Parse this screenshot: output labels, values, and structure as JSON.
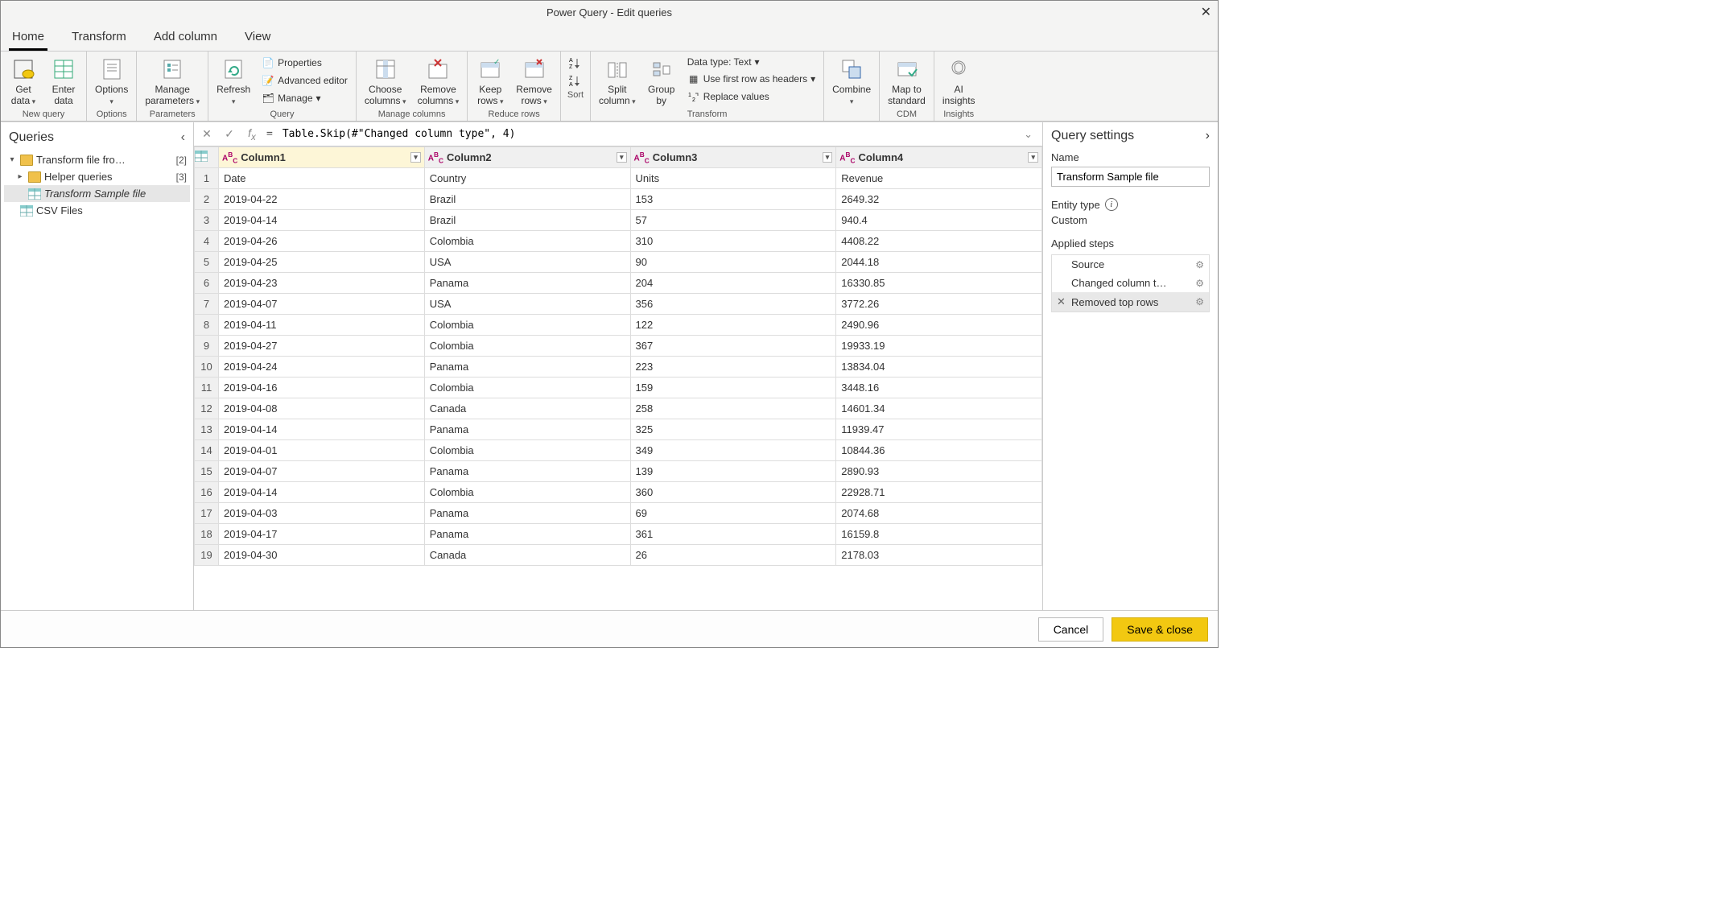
{
  "title": "Power Query - Edit queries",
  "tabs": [
    "Home",
    "Transform",
    "Add column",
    "View"
  ],
  "activeTab": 0,
  "ribbon": {
    "groups": [
      {
        "label": "New query",
        "items": [
          "Get data",
          "Enter data"
        ]
      },
      {
        "label": "Options",
        "items": [
          "Options"
        ]
      },
      {
        "label": "Parameters",
        "items": [
          "Manage parameters"
        ]
      },
      {
        "label": "Query",
        "items": [
          "Refresh"
        ],
        "small": [
          "Properties",
          "Advanced editor",
          "Manage"
        ]
      },
      {
        "label": "Manage columns",
        "items": [
          "Choose columns",
          "Remove columns"
        ]
      },
      {
        "label": "Reduce rows",
        "items": [
          "Keep rows",
          "Remove rows"
        ]
      },
      {
        "label": "Sort",
        "items": []
      },
      {
        "label": "Transform",
        "items": [
          "Split column",
          "Group by"
        ],
        "small": [
          "Data type: Text",
          "Use first row as headers",
          "Replace values"
        ]
      },
      {
        "label": "",
        "items": [
          "Combine"
        ]
      },
      {
        "label": "CDM",
        "items": [
          "Map to standard"
        ]
      },
      {
        "label": "Insights",
        "items": [
          "AI insights"
        ]
      }
    ]
  },
  "queriesPane": {
    "title": "Queries",
    "items": [
      {
        "type": "folder",
        "label": "Transform file fro…",
        "count": "[2]",
        "level": 0,
        "expanded": true
      },
      {
        "type": "folder",
        "label": "Helper queries",
        "count": "[3]",
        "level": 1,
        "expanded": false
      },
      {
        "type": "query",
        "label": "Transform Sample file",
        "level": 1,
        "selected": true
      },
      {
        "type": "query",
        "label": "CSV Files",
        "level": 0
      }
    ]
  },
  "formula": "Table.Skip(#\"Changed column type\", 4)",
  "columns": [
    "Column1",
    "Column2",
    "Column3",
    "Column4"
  ],
  "rows": [
    [
      "Date",
      "Country",
      "Units",
      "Revenue"
    ],
    [
      "2019-04-22",
      "Brazil",
      "153",
      "2649.32"
    ],
    [
      "2019-04-14",
      "Brazil",
      "57",
      "940.4"
    ],
    [
      "2019-04-26",
      "Colombia",
      "310",
      "4408.22"
    ],
    [
      "2019-04-25",
      "USA",
      "90",
      "2044.18"
    ],
    [
      "2019-04-23",
      "Panama",
      "204",
      "16330.85"
    ],
    [
      "2019-04-07",
      "USA",
      "356",
      "3772.26"
    ],
    [
      "2019-04-11",
      "Colombia",
      "122",
      "2490.96"
    ],
    [
      "2019-04-27",
      "Colombia",
      "367",
      "19933.19"
    ],
    [
      "2019-04-24",
      "Panama",
      "223",
      "13834.04"
    ],
    [
      "2019-04-16",
      "Colombia",
      "159",
      "3448.16"
    ],
    [
      "2019-04-08",
      "Canada",
      "258",
      "14601.34"
    ],
    [
      "2019-04-14",
      "Panama",
      "325",
      "11939.47"
    ],
    [
      "2019-04-01",
      "Colombia",
      "349",
      "10844.36"
    ],
    [
      "2019-04-07",
      "Panama",
      "139",
      "2890.93"
    ],
    [
      "2019-04-14",
      "Colombia",
      "360",
      "22928.71"
    ],
    [
      "2019-04-03",
      "Panama",
      "69",
      "2074.68"
    ],
    [
      "2019-04-17",
      "Panama",
      "361",
      "16159.8"
    ],
    [
      "2019-04-30",
      "Canada",
      "26",
      "2178.03"
    ]
  ],
  "settings": {
    "title": "Query settings",
    "nameLabel": "Name",
    "name": "Transform Sample file",
    "entityTypeLabel": "Entity type",
    "entityType": "Custom",
    "appliedLabel": "Applied steps",
    "steps": [
      {
        "label": "Source",
        "gear": true
      },
      {
        "label": "Changed column t…",
        "gear": true
      },
      {
        "label": "Removed top rows",
        "gear": true,
        "selected": true,
        "deletable": true
      }
    ]
  },
  "footer": {
    "cancel": "Cancel",
    "save": "Save & close"
  }
}
